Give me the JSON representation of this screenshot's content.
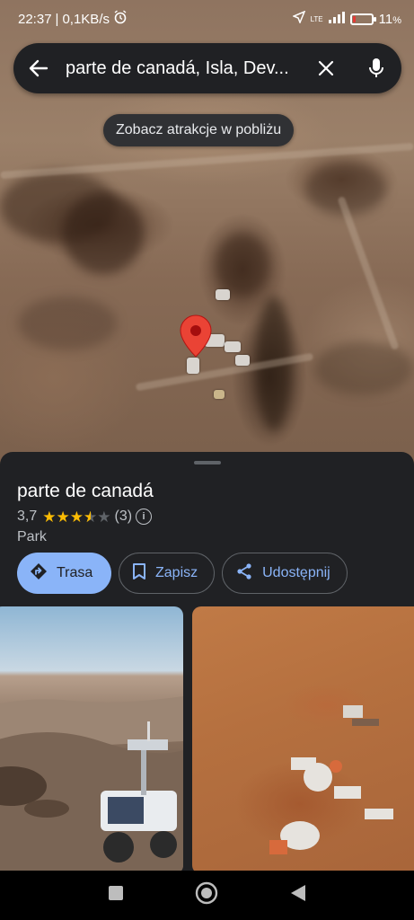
{
  "status_bar": {
    "time": "22:37",
    "separator": "|",
    "network_speed": "0,1KB/s",
    "network_type": "LTE",
    "battery_percent": "11",
    "battery_suffix": "%",
    "icons": [
      "alarm-icon",
      "location-arrow-icon",
      "signal-icon",
      "battery-icon"
    ]
  },
  "search": {
    "query": "parte de canadá, Isla, Dev...",
    "icons": [
      "back-arrow-icon",
      "close-icon",
      "mic-icon"
    ]
  },
  "map": {
    "chip_label": "Zobacz atrakcje w pobliżu",
    "pin_color": "#ea4335"
  },
  "place": {
    "title": "parte de canadá",
    "rating": "3,7",
    "rating_value": 3.7,
    "stars_max": 5,
    "review_count": "(3)",
    "category": "Park"
  },
  "actions": {
    "directions_label": "Trasa",
    "save_label": "Zapisz",
    "share_label": "Udostępnij"
  },
  "colors": {
    "accent": "#8ab4f8",
    "sheet_background": "#202124",
    "star": "#fbbc04"
  },
  "navigation": {
    "buttons": [
      "recents-square-icon",
      "home-circle-icon",
      "back-triangle-icon"
    ]
  }
}
